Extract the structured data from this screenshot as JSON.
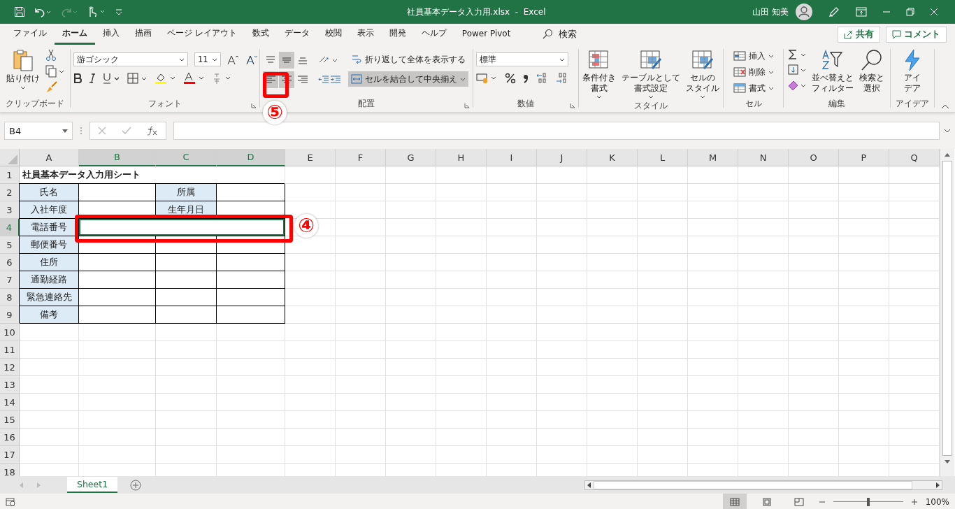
{
  "title_bar": {
    "title": "社員基本データ入力用.xlsx  -  Excel",
    "user": "山田 知美"
  },
  "ribbon_tabs": [
    {
      "label": "ファイル",
      "selected": false
    },
    {
      "label": "ホーム",
      "selected": true
    },
    {
      "label": "挿入",
      "selected": false
    },
    {
      "label": "描画",
      "selected": false
    },
    {
      "label": "ページ レイアウト",
      "selected": false
    },
    {
      "label": "数式",
      "selected": false
    },
    {
      "label": "データ",
      "selected": false
    },
    {
      "label": "校閲",
      "selected": false
    },
    {
      "label": "表示",
      "selected": false
    },
    {
      "label": "開発",
      "selected": false
    },
    {
      "label": "ヘルプ",
      "selected": false
    },
    {
      "label": "Power Pivot",
      "selected": false
    }
  ],
  "search": {
    "label": "検索"
  },
  "share_button": "共有",
  "comment_button": "コメント",
  "ribbon": {
    "clipboard": {
      "paste": "貼り付け",
      "label": "クリップボード"
    },
    "font": {
      "font_name": "游ゴシック",
      "font_size": "11",
      "label": "フォント"
    },
    "alignment": {
      "vertical_align": [
        {
          "selected": false
        },
        {
          "selected": true
        },
        {
          "selected": false
        }
      ],
      "horizontal_align": [
        {
          "selected": true
        },
        {
          "selected": true
        },
        {
          "selected": false
        }
      ],
      "wrap_text": "折り返して全体を表示する",
      "merge_center": {
        "label": "セルを結合して中央揃え",
        "selected": true
      },
      "label": "配置"
    },
    "number": {
      "format": "標準",
      "label": "数値"
    },
    "styles": {
      "buttons": [
        {
          "lines": [
            "条件付き",
            "書式"
          ]
        },
        {
          "lines": [
            "テーブルとして",
            "書式設定"
          ]
        },
        {
          "lines": [
            "セルの",
            "スタイル"
          ]
        }
      ],
      "label": "スタイル"
    },
    "cells": {
      "buttons": [
        "挿入",
        "削除",
        "書式"
      ],
      "label": "セル"
    },
    "editing": {
      "buttons": [
        {
          "lines": [
            "並べ替えと",
            "フィルター"
          ]
        },
        {
          "lines": [
            "検索と",
            "選択"
          ]
        }
      ],
      "label": "編集"
    },
    "ideas": {
      "lines": [
        "アイ",
        "デア"
      ],
      "label": "アイデア"
    }
  },
  "formula_bar": {
    "name_box": "B4"
  },
  "grid": {
    "columns": [
      {
        "label": "A",
        "selected": false
      },
      {
        "label": "B",
        "selected": true
      },
      {
        "label": "C",
        "selected": true
      },
      {
        "label": "D",
        "selected": true
      },
      {
        "label": "E",
        "selected": false
      },
      {
        "label": "F",
        "selected": false
      },
      {
        "label": "G",
        "selected": false
      },
      {
        "label": "H",
        "selected": false
      },
      {
        "label": "I",
        "selected": false
      },
      {
        "label": "J",
        "selected": false
      },
      {
        "label": "K",
        "selected": false
      },
      {
        "label": "L",
        "selected": false
      },
      {
        "label": "M",
        "selected": false
      },
      {
        "label": "N",
        "selected": false
      },
      {
        "label": "O",
        "selected": false
      },
      {
        "label": "P",
        "selected": false
      },
      {
        "label": "Q",
        "selected": false
      }
    ],
    "rows": [
      {
        "header": "1",
        "selected": false,
        "cells": [
          {
            "kind": "title",
            "text": "社員基本データ入力用シート"
          },
          {
            "kind": "spill"
          },
          {
            "kind": "spill"
          }
        ]
      },
      {
        "header": "2",
        "selected": false,
        "cells": [
          {
            "kind": "label",
            "text": "氏名"
          },
          {
            "kind": "blank"
          },
          {
            "kind": "label",
            "text": "所属"
          },
          {
            "kind": "blank"
          }
        ]
      },
      {
        "header": "3",
        "selected": false,
        "cells": [
          {
            "kind": "label",
            "text": "入社年度"
          },
          {
            "kind": "blank"
          },
          {
            "kind": "label",
            "text": "生年月日"
          },
          {
            "kind": "blank"
          }
        ]
      },
      {
        "header": "4",
        "selected": true,
        "cells": [
          {
            "kind": "label",
            "text": "電話番号"
          },
          {
            "kind": "blank",
            "selected": true
          },
          {
            "kind": "merged"
          },
          {
            "kind": "merged"
          }
        ]
      },
      {
        "header": "5",
        "selected": false,
        "cells": [
          {
            "kind": "label",
            "text": "郵便番号"
          },
          {
            "kind": "blank"
          },
          {
            "kind": "blank"
          },
          {
            "kind": "blank"
          }
        ]
      },
      {
        "header": "6",
        "selected": false,
        "cells": [
          {
            "kind": "label",
            "text": "住所"
          },
          {
            "kind": "blank"
          },
          {
            "kind": "blank"
          },
          {
            "kind": "blank"
          }
        ]
      },
      {
        "header": "7",
        "selected": false,
        "cells": [
          {
            "kind": "label",
            "text": "通勤経路"
          },
          {
            "kind": "blank"
          },
          {
            "kind": "blank"
          },
          {
            "kind": "blank"
          }
        ]
      },
      {
        "header": "8",
        "selected": false,
        "cells": [
          {
            "kind": "label",
            "text": "緊急連絡先"
          },
          {
            "kind": "blank"
          },
          {
            "kind": "blank"
          },
          {
            "kind": "blank"
          }
        ]
      },
      {
        "header": "9",
        "selected": false,
        "cells": [
          {
            "kind": "label",
            "text": "備考"
          },
          {
            "kind": "blank"
          },
          {
            "kind": "blank"
          },
          {
            "kind": "blank"
          }
        ]
      },
      {
        "header": "10",
        "selected": false
      },
      {
        "header": "11",
        "selected": false
      },
      {
        "header": "12",
        "selected": false
      },
      {
        "header": "13",
        "selected": false
      },
      {
        "header": "14",
        "selected": false
      },
      {
        "header": "15",
        "selected": false
      },
      {
        "header": "16",
        "selected": false
      },
      {
        "header": "17",
        "selected": false
      },
      {
        "header": "18",
        "selected": false
      }
    ]
  },
  "sheet_tabs": [
    {
      "label": "Sheet1",
      "selected": true
    }
  ],
  "status_bar": {
    "views": [
      {
        "selected": true
      },
      {
        "selected": false
      },
      {
        "selected": false
      }
    ],
    "zoom_slider": {
      "level": 0.5
    },
    "zoom": "100%"
  },
  "annotations": [
    {
      "kind": "cell",
      "label": "④"
    },
    {
      "kind": "ribbon",
      "label": "⑤"
    }
  ]
}
